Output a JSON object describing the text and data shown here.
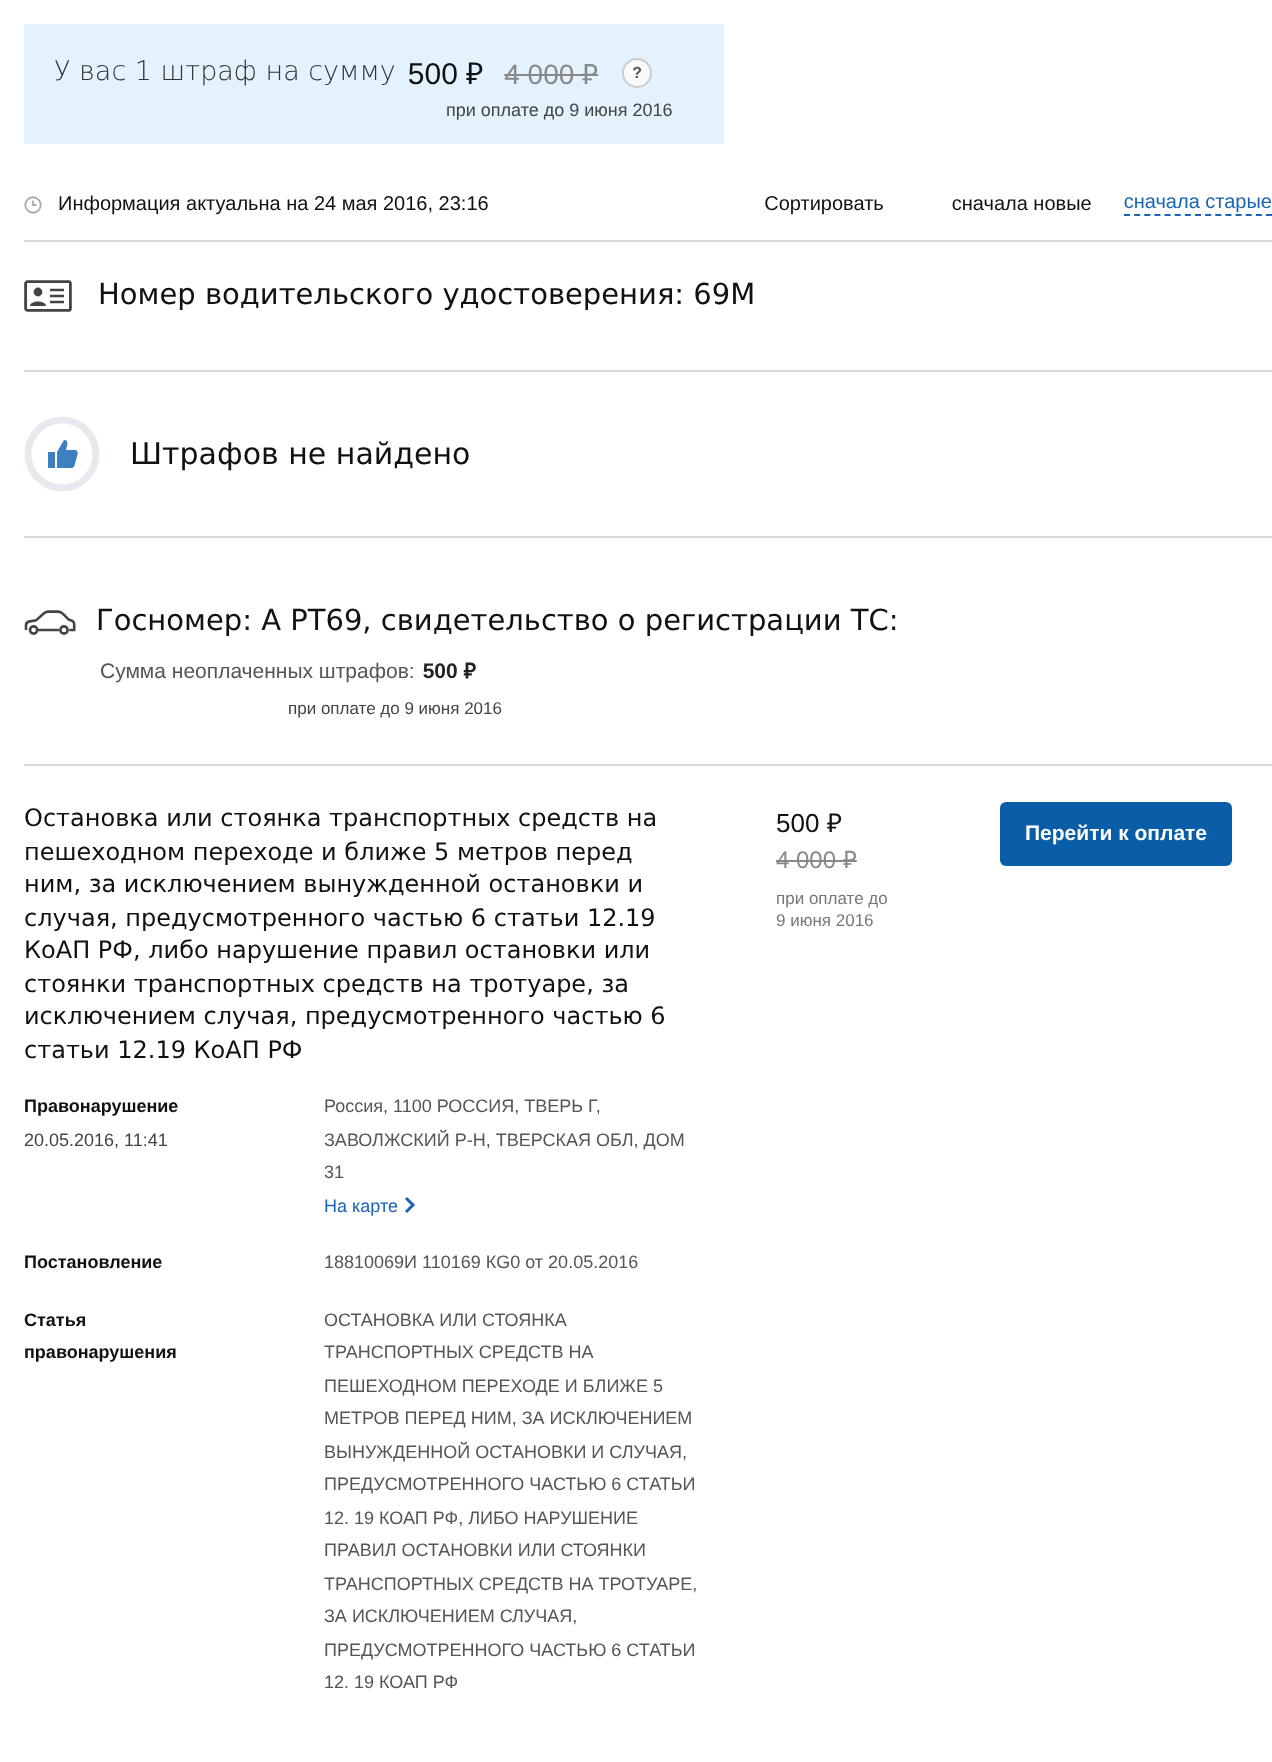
{
  "summary": {
    "text": "У вас 1 штраф на сумму",
    "amount": "500 ₽",
    "old_amount": "4 000 ₽",
    "help": "?",
    "note": "при оплате до 9 июня 2016"
  },
  "info": {
    "text": "Информация актуальна на 24 мая 2016, 23:16",
    "sort_label": "Сортировать",
    "sort_options": [
      {
        "label": "сначала новые",
        "selected": true
      },
      {
        "label": "сначала старые",
        "selected": false
      }
    ]
  },
  "sections": [
    {
      "kind": "license",
      "title": "Номер водительского удостоверения: 69М"
    },
    {
      "kind": "empty",
      "title": "Штрафов не найдено"
    },
    {
      "kind": "vehicle",
      "title": "Госномер: А РТ69, свидетельство о регистрации ТС:",
      "sum_label": "Сумма неоплаченных штрафов:",
      "sum": "500 ₽",
      "note": "при оплате до 9 июня 2016"
    }
  ],
  "fine": {
    "description": "Остановка или стоянка транспортных средств на пешеходном переходе и ближе 5 метров перед ним, за исключением вынужденной остановки и случая, предусмотренного частью 6 статьи 12.19 КоАП РФ, либо нарушение правил остановки или стоянки транспортных средств на тротуаре, за исключением случая, предусмотренного частью 6 статьи 12.19 КоАП РФ",
    "amount": "500 ₽",
    "old_amount": "4 000 ₽",
    "note": "при оплате до 9 июня 2016",
    "pay_button": "Перейти к оплате",
    "details": [
      {
        "label": "Правонарушение",
        "sub": "20.05.2016, 11:41",
        "value": "Россия, 1100 РОССИЯ, ТВЕРЬ Г, ЗАВОЛЖСКИЙ Р-Н, ТВЕРСКАЯ ОБЛ, ДОМ 31",
        "link": "На карте"
      },
      {
        "label": "Постановление",
        "value": "18810069И 110169 КG0 от 20.05.2016"
      },
      {
        "label": "Статья правонарушения",
        "value": "ОСТАНОВКА ИЛИ СТОЯНКА ТРАНСПОРТНЫХ СРЕДСТВ НА ПЕШЕХОДНОМ ПЕРЕХОДЕ И БЛИЖЕ 5 МЕТРОВ ПЕРЕД НИМ, ЗА ИСКЛЮЧЕНИЕМ ВЫНУЖДЕННОЙ ОСТАНОВКИ И СЛУЧАЯ, ПРЕДУСМОТРЕННОГО ЧАСТЬЮ 6 СТАТЬИ 12. 19 КОАП РФ, ЛИБО НАРУШЕНИЕ ПРАВИЛ ОСТАНОВКИ ИЛИ СТОЯНКИ ТРАНСПОРТНЫХ СРЕДСТВ НА ТРОТУАРЕ, ЗА ИСКЛЮЧЕНИЕМ СЛУЧАЯ, ПРЕДУСМОТРЕННОГО ЧАСТЬЮ 6 СТАТЬИ 12. 19 КОАП РФ"
      }
    ]
  }
}
